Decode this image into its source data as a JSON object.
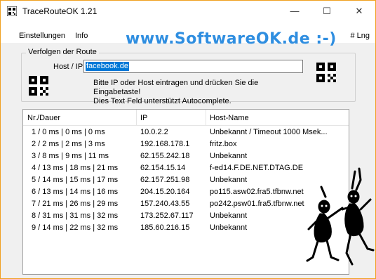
{
  "window": {
    "title": "TraceRouteOK 1.21",
    "controls": {
      "minimize": "—",
      "maximize": "☐",
      "close": "✕"
    }
  },
  "menu": {
    "items": [
      "Einstellungen",
      "Info"
    ],
    "language": "# Lng"
  },
  "brand": "www.SoftwareOK.de :-)",
  "route_group": {
    "legend": "Verfolgen der Route",
    "host_label": "Host / IP :",
    "host_value": "facebook.de",
    "hint_line1": "Bitte IP oder Host eintragen und drücken Sie die Eingabetaste!",
    "hint_line2": "Dies Text Feld unterstützt Autocomplete."
  },
  "table": {
    "columns": [
      "Nr./Dauer",
      "IP",
      "Host-Name"
    ],
    "rows": [
      [
        "1 / 0 ms | 0 ms | 0 ms",
        "10.0.2.2",
        "Unbekannt / Timeout 1000 Msek..."
      ],
      [
        "2 / 2 ms | 2 ms | 3 ms",
        "192.168.178.1",
        "fritz.box"
      ],
      [
        "3 / 8 ms | 9 ms | 11 ms",
        "62.155.242.18",
        "Unbekannt"
      ],
      [
        "4 / 13 ms | 18 ms | 21 ms",
        "62.154.15.14",
        "f-ed14.F.DE.NET.DTAG.DE"
      ],
      [
        "5 / 14 ms | 15 ms | 17 ms",
        "62.157.251.98",
        "Unbekannt"
      ],
      [
        "6 / 13 ms | 14 ms | 16 ms",
        "204.15.20.164",
        "po115.asw02.fra5.tfbnw.net"
      ],
      [
        "7 / 21 ms | 26 ms | 29 ms",
        "157.240.43.55",
        "po242.psw01.fra5.tfbnw.net"
      ],
      [
        "8 / 31 ms | 31 ms | 32 ms",
        "173.252.67.117",
        "Unbekannt"
      ],
      [
        "9 / 14 ms | 22 ms | 32 ms",
        "185.60.216.15",
        "Unbekannt"
      ]
    ]
  },
  "colors": {
    "brand": "#2f8ee0",
    "selection": "#0078d7",
    "window_border": "#f0a020"
  },
  "icons": [
    "app-icon",
    "qr-code-icon",
    "dancing-figures-icon"
  ]
}
